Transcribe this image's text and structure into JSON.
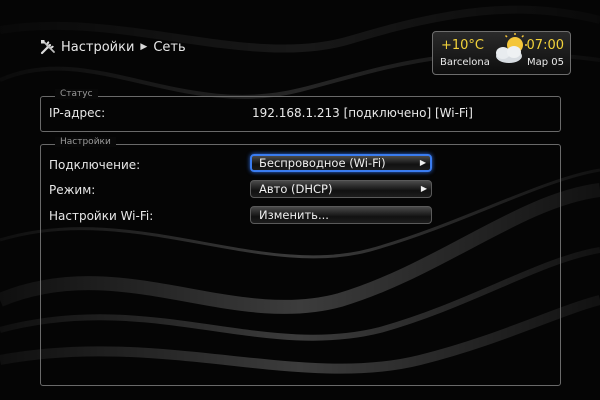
{
  "breadcrumb": {
    "root": "Настройки",
    "current": "Сеть"
  },
  "widget": {
    "temperature": "+10°C",
    "city": "Barcelona",
    "time": "07:00",
    "date": "Мар 05",
    "weather_icon": "partly-cloudy-icon"
  },
  "status": {
    "legend": "Статус",
    "ip_label": "IP-адрес:",
    "ip_value": "192.168.1.213 [подключено] [Wi-Fi]"
  },
  "settings": {
    "legend": "Настройки",
    "rows": [
      {
        "label": "Подключение:",
        "value": "Беспроводное (Wi-Fi)"
      },
      {
        "label": "Режим:",
        "value": "Авто (DHCP)"
      },
      {
        "label": "Настройки Wi-Fi:",
        "value": "Изменить..."
      }
    ]
  },
  "colors": {
    "accent": "#f2d23a",
    "focus": "#3a7cf0"
  }
}
